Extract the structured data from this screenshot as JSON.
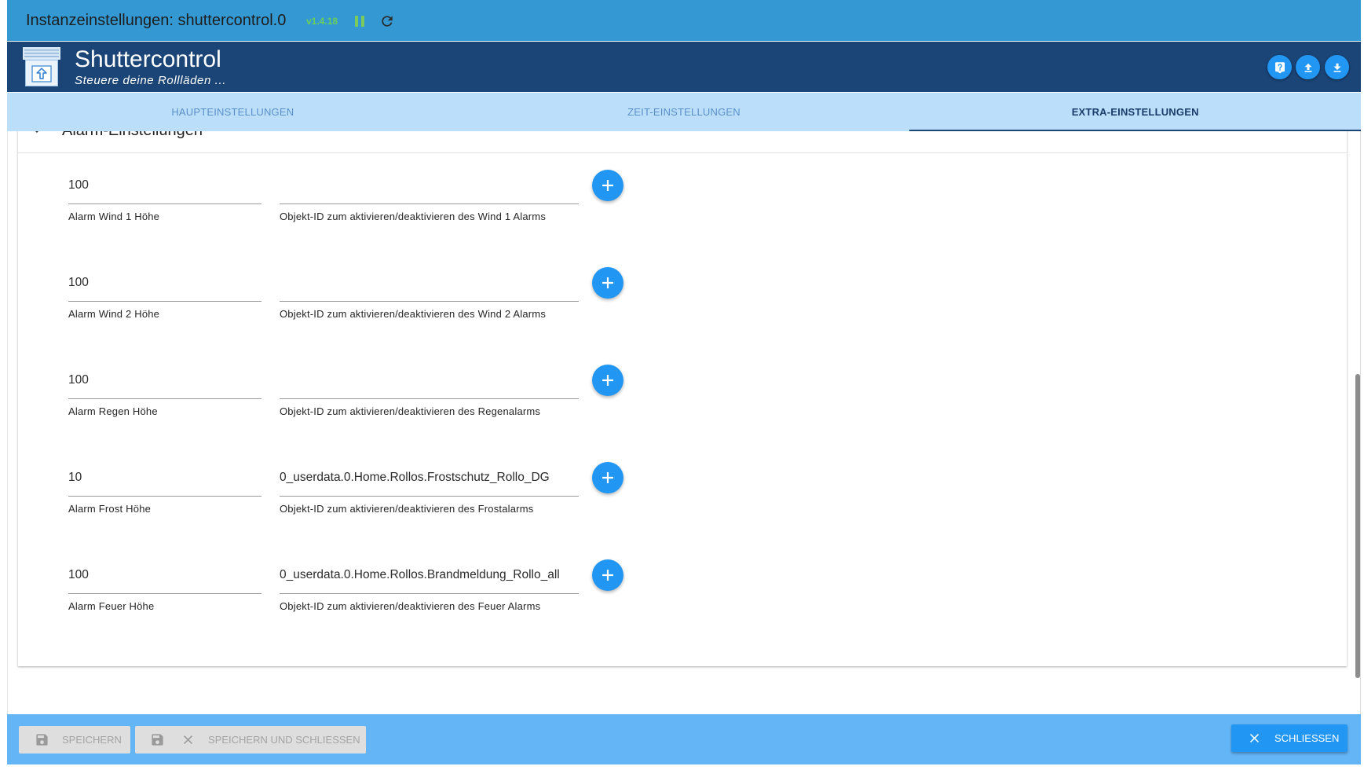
{
  "window": {
    "title": "Instanzeinstellungen: shuttercontrol.0",
    "version": "v1.4.18"
  },
  "header": {
    "app_name": "Shuttercontrol",
    "subtitle": "Steuere deine Rollläden ...",
    "actions": [
      {
        "icon": "help-icon"
      },
      {
        "icon": "upload-icon"
      },
      {
        "icon": "download-icon"
      }
    ]
  },
  "tabs": [
    {
      "label": "HAUPTEINSTELLUNGEN"
    },
    {
      "label": "ZEIT-EINSTELLUNGEN"
    },
    {
      "label": "EXTRA-EINSTELLUNGEN"
    }
  ],
  "active_tab_index": 2,
  "section": {
    "title": "Alarm-Einstellungen",
    "expanded": true
  },
  "alarms": [
    {
      "value": "100",
      "value_label": "Alarm Wind 1 Höhe",
      "object_id": "",
      "object_label": "Objekt-ID zum aktivieren/deaktivieren des Wind 1 Alarms"
    },
    {
      "value": "100",
      "value_label": "Alarm Wind 2 Höhe",
      "object_id": "",
      "object_label": "Objekt-ID zum aktivieren/deaktivieren des Wind 2 Alarms"
    },
    {
      "value": "100",
      "value_label": "Alarm Regen Höhe",
      "object_id": "",
      "object_label": "Objekt-ID zum aktivieren/deaktivieren des Regenalarms"
    },
    {
      "value": "10",
      "value_label": "Alarm Frost Höhe",
      "object_id": "0_userdata.0.Home.Rollos.Frostschutz_Rollo_DG",
      "object_label": "Objekt-ID zum aktivieren/deaktivieren des Frostalarms"
    },
    {
      "value": "100",
      "value_label": "Alarm Feuer Höhe",
      "object_id": "0_userdata.0.Home.Rollos.Brandmeldung_Rollo_all",
      "object_label": "Objekt-ID zum aktivieren/deaktivieren des Feuer Alarms"
    }
  ],
  "footer": {
    "save_label": "SPEICHERN",
    "save_close_label": "SPEICHERN UND SCHLIESSEN",
    "close_label": "SCHLIESSEN",
    "save_disabled": true,
    "save_close_disabled": true
  },
  "colors": {
    "title_bar": "#3498d3",
    "header": "#1b4577",
    "tabs": "#bbdefb",
    "footer": "#64b5f6",
    "accent": "#2196f3",
    "version": "#6ad05a"
  }
}
